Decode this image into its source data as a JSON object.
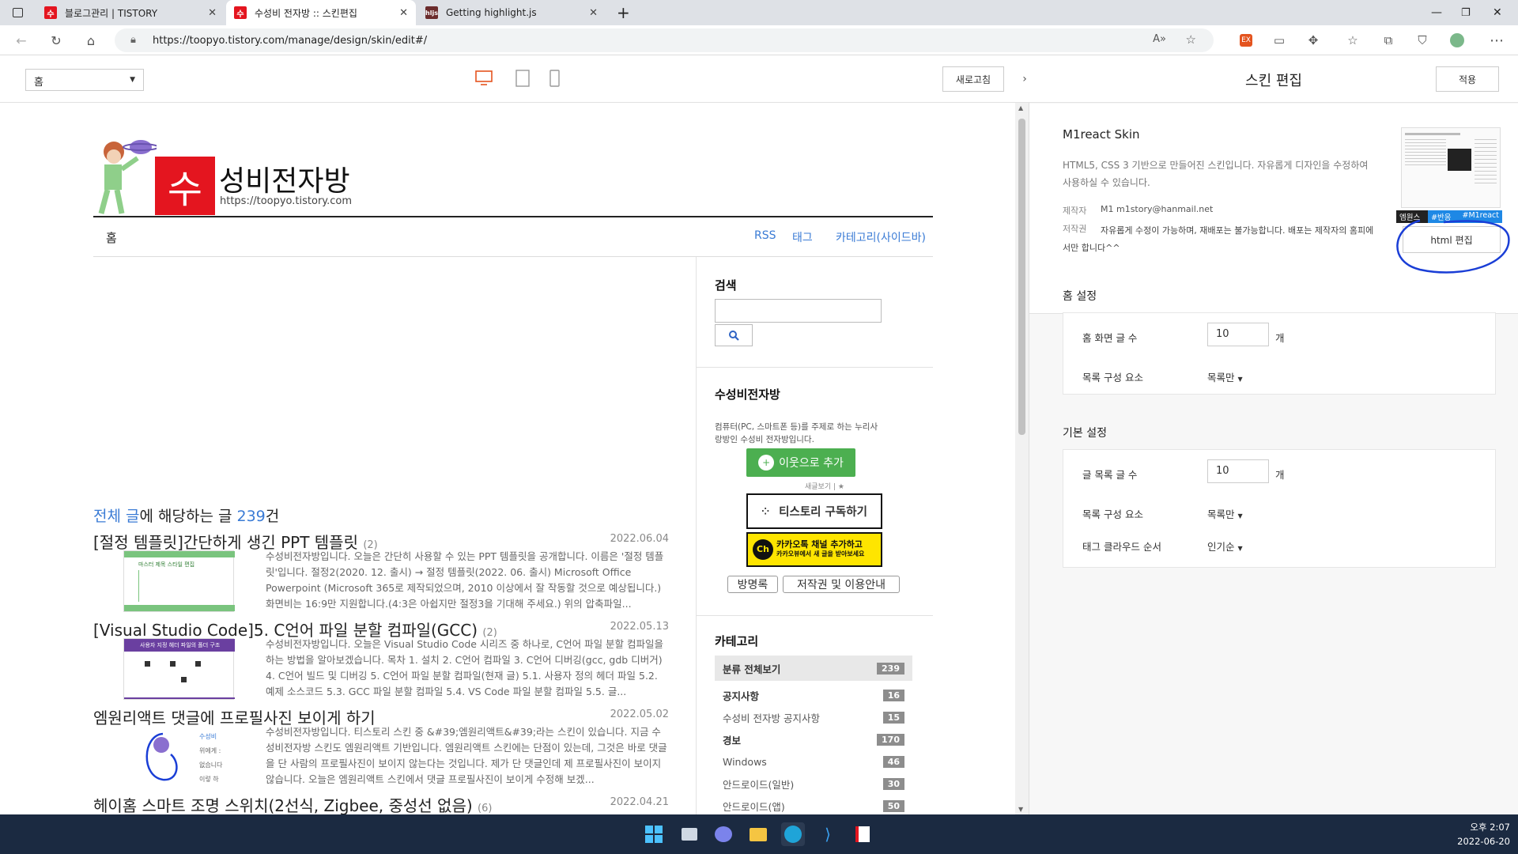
{
  "browser": {
    "tabs": [
      {
        "label": "블로그관리 | TISTORY"
      },
      {
        "label": "수성비 전자방 :: 스킨편집"
      },
      {
        "label": "Getting highlight.js"
      }
    ],
    "url": "https://toopyo.tistory.com/manage/design/skin/edit#/"
  },
  "editor": {
    "page_select": "홈",
    "refresh_label": "새로고침",
    "panel_title": "스킨 편집",
    "apply_label": "적용"
  },
  "blog": {
    "logo_char": "수",
    "title": "성비전자방",
    "url": "https://toopyo.tistory.com",
    "nav_home": "홈",
    "nav_links": [
      "RSS",
      "태그",
      "카테고리(사이드바)"
    ],
    "summary_prefix": "전체 글",
    "summary_mid": "에 해당하는 글 ",
    "summary_count": "239",
    "summary_suffix": "건",
    "posts": [
      {
        "title": "[절정 템플릿]간단하게 생긴 PPT 템플릿",
        "count": "(2)",
        "date": "2022.06.04",
        "excerpt": "수성비전자방입니다. 오늘은 간단히 사용할 수 있는 PPT 템플릿을 공개합니다. 이름은 '절정 템플릿'입니다. 절정2(2020. 12. 출시) → 절정 템플릿(2022. 06. 출시) Microsoft Office Powerpoint (Microsoft 365로 제작되었으며, 2010 이상에서 잘 작동할 것으로 예상됩니다.) 화면비는 16:9만 지원합니다.(4:3은 아쉽지만 절정3을 기대해 주세요.) 위의 압축파일..."
      },
      {
        "title": "[Visual Studio Code]5. C언어 파일 분할 컴파일(GCC)",
        "count": "(2)",
        "date": "2022.05.13",
        "excerpt": "수성비전자방입니다. 오늘은 Visual Studio Code 시리즈 중 하나로, C언어 파일 분할 컴파일을 하는 방법을 알아보겠습니다. 목차 1. 설치 2. C언어 컴파일 3. C언어 디버깅(gcc, gdb 디버거) 4. C언어 빌드 및 디버깅 5. C언어 파일 분할 컴파일(현재 글) 5.1. 사용자 정의 헤더 파일 5.2. 예제 소스코드 5.3. GCC 파일 분할 컴파일 5.4. VS Code 파일 분할 컴파일 5.5. 글..."
      },
      {
        "title": "엠원리액트 댓글에 프로필사진 보이게 하기",
        "count": "",
        "date": "2022.05.02",
        "excerpt": "수성비전자방입니다. 티스토리 스킨 중 &#39;엠원리액트&#39;라는 스킨이 있습니다. 지금 수성비전자방 스킨도 엠원리액트 기반입니다. 엠원리액트 스킨에는 단점이 있는데, 그것은 바로 댓글을 단 사람의 프로필사진이 보이지 않는다는 것입니다. 제가 단 댓글인데 제 프로필사진이 보이지 않습니다. 오늘은 엠원리액트 스킨에서 댓글 프로필사진이 보이게 수정해 보겠..."
      },
      {
        "title": "헤이홈 스마트 조명 스위치(2선식, Zigbee, 중성선 없음)",
        "count": "(6)",
        "date": "2022.04.21",
        "excerpt": ""
      }
    ],
    "thumb_texts": {
      "ppt": "마스터 제목 스타일 편집",
      "vsc": "사용자 지정 헤더 파일의 폴더 구조",
      "m1": [
        "수성비",
        "위에게 :",
        "없습니다",
        "이렇 하"
      ]
    },
    "sidebar": {
      "search_title": "검색",
      "profile_title": "수성비전자방",
      "profile_desc": "컴퓨터(PC, 스마트폰 등)를 주제로 하는 누리사랑방인 수성비 전자방입니다.",
      "add_neighbor": "이웃으로 추가",
      "neighbor_sub": "새글보기 | ★",
      "tistory_subscribe": "티스토리 구독하기",
      "kakao_line1": "카카오톡 채널 추가하고",
      "kakao_line2": "카카오뷰에서 새 글을 받아보세요",
      "guestbook": "방명록",
      "copyright": "저작권 및 이용안내",
      "category_title": "카테고리",
      "categories": [
        {
          "name": "분류 전체보기",
          "count": "239"
        },
        {
          "name": "공지사항",
          "count": "16"
        },
        {
          "name": "수성비 전자방 공지사항",
          "count": "15"
        },
        {
          "name": "경보",
          "count": "170"
        },
        {
          "name": "Windows",
          "count": "46"
        },
        {
          "name": "안드로이드(일반)",
          "count": "30"
        },
        {
          "name": "안드로이드(앱)",
          "count": "50"
        }
      ]
    }
  },
  "skin": {
    "name": "M1react Skin",
    "description": "HTML5, CSS 3 기반으로 만들어진 스킨입니다. 자유롭게 디자인을 수정하여 사용하실 수 있습니다.",
    "maker_label": "제작자",
    "maker_value": "M1  m1story@hanmail.net",
    "license_label": "저작권",
    "license_value": "자유롭게 수정이 가능하며, 재배포는 불가능합니다. 배포는 제작자의 홈피에서만 합니다^^",
    "html_edit": "html 편집",
    "thumb_tags": [
      "엠원스킨",
      "#반응형",
      "#M1react"
    ],
    "home_section": "홈 설정",
    "home_rows": [
      {
        "label": "홈 화면 글 수",
        "value": "10",
        "unit": "개"
      },
      {
        "label": "목록 구성 요소",
        "select": "목록만"
      }
    ],
    "basic_section": "기본 설정",
    "basic_rows": [
      {
        "label": "글 목록 글 수",
        "value": "10",
        "unit": "개"
      },
      {
        "label": "목록 구성 요소",
        "select": "목록만"
      },
      {
        "label": "태그 클라우드 순서",
        "select": "인기순"
      }
    ]
  },
  "clock": {
    "time": "오후 2:07",
    "date": "2022-06-20"
  },
  "colors": {
    "tistory_red": "#e4151f",
    "link_blue": "#3a7bd5",
    "taskbar": "#1b2a41",
    "neighbor_green": "#4caf50",
    "kakao_yellow": "#fee500"
  }
}
